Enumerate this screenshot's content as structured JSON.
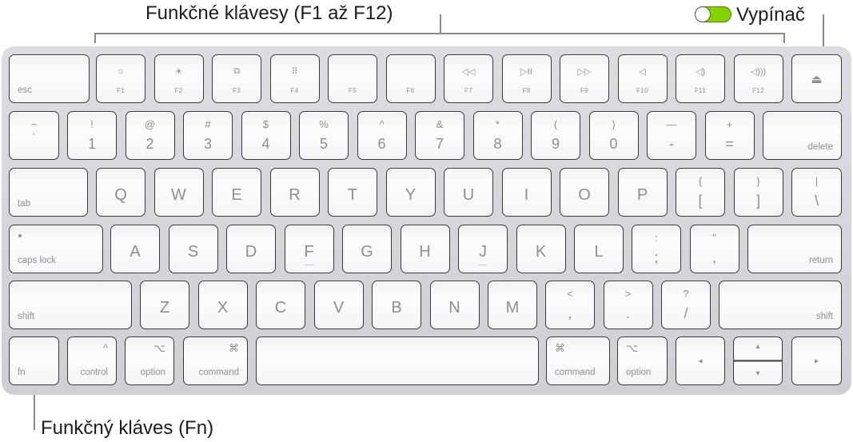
{
  "callouts": {
    "function_keys": "Funkčné klávesy (F1 až F12)",
    "power_switch": "Vypínač",
    "fn_key": "Funkčný kláves (Fn)"
  },
  "toggle": {
    "state": "on",
    "on_color": "#86d300"
  },
  "keyboard": {
    "row_function": {
      "esc": "esc",
      "keys": [
        {
          "label": "F1",
          "icon": "☼",
          "icon_name": "brightness-down-icon"
        },
        {
          "label": "F2",
          "icon": "☀",
          "icon_name": "brightness-up-icon"
        },
        {
          "label": "F3",
          "icon": "⧉",
          "icon_name": "mission-control-icon"
        },
        {
          "label": "F4",
          "icon": "⠿",
          "icon_name": "launchpad-icon"
        },
        {
          "label": "F5",
          "icon": "",
          "icon_name": ""
        },
        {
          "label": "F6",
          "icon": "",
          "icon_name": ""
        },
        {
          "label": "F7",
          "icon": "◁◁",
          "icon_name": "rewind-icon"
        },
        {
          "label": "F8",
          "icon": "▷II",
          "icon_name": "play-pause-icon"
        },
        {
          "label": "F9",
          "icon": "▷▷",
          "icon_name": "fast-forward-icon"
        },
        {
          "label": "F10",
          "icon": "◁",
          "icon_name": "mute-icon"
        },
        {
          "label": "F11",
          "icon": "◁)",
          "icon_name": "volume-down-icon"
        },
        {
          "label": "F12",
          "icon": "◁)))",
          "icon_name": "volume-up-icon"
        }
      ],
      "eject": "⏏"
    },
    "row_number": {
      "keys": [
        {
          "upper": "~",
          "lower": "`"
        },
        {
          "upper": "!",
          "lower": "1"
        },
        {
          "upper": "@",
          "lower": "2"
        },
        {
          "upper": "#",
          "lower": "3"
        },
        {
          "upper": "$",
          "lower": "4"
        },
        {
          "upper": "%",
          "lower": "5"
        },
        {
          "upper": "^",
          "lower": "6"
        },
        {
          "upper": "&",
          "lower": "7"
        },
        {
          "upper": "*",
          "lower": "8"
        },
        {
          "upper": "(",
          "lower": "9"
        },
        {
          "upper": ")",
          "lower": "0"
        },
        {
          "upper": "—",
          "lower": "-"
        },
        {
          "upper": "+",
          "lower": "="
        }
      ],
      "delete": "delete"
    },
    "row_qwerty": {
      "tab": "tab",
      "letters": [
        "Q",
        "W",
        "E",
        "R",
        "T",
        "Y",
        "U",
        "I",
        "O",
        "P"
      ],
      "brackets": [
        {
          "upper": "{",
          "lower": "["
        },
        {
          "upper": "}",
          "lower": "]"
        },
        {
          "upper": "|",
          "lower": "\\"
        }
      ]
    },
    "row_home": {
      "caps_lock": "caps lock",
      "letters": [
        "A",
        "S",
        "D",
        "F",
        "G",
        "H",
        "J",
        "K",
        "L"
      ],
      "punct": [
        {
          "upper": ":",
          "lower": ";"
        },
        {
          "upper": "\"",
          "lower": ","
        }
      ],
      "return": "return"
    },
    "row_shift": {
      "shift_left": "shift",
      "letters": [
        "Z",
        "X",
        "C",
        "V",
        "B",
        "N",
        "M"
      ],
      "punct": [
        {
          "upper": "<",
          "lower": ","
        },
        {
          "upper": ">",
          "lower": "."
        },
        {
          "upper": "?",
          "lower": "/"
        }
      ],
      "shift_right": "shift"
    },
    "row_bottom": {
      "fn": "fn",
      "control": "control",
      "control_glyph": "^",
      "option_left": "option",
      "option_glyph": "⌥",
      "command_left": "command",
      "command_glyph": "⌘",
      "command_right": "command",
      "option_right": "option",
      "arrow_left": "◂",
      "arrow_up": "▴",
      "arrow_down": "▾",
      "arrow_right": "▸"
    }
  }
}
